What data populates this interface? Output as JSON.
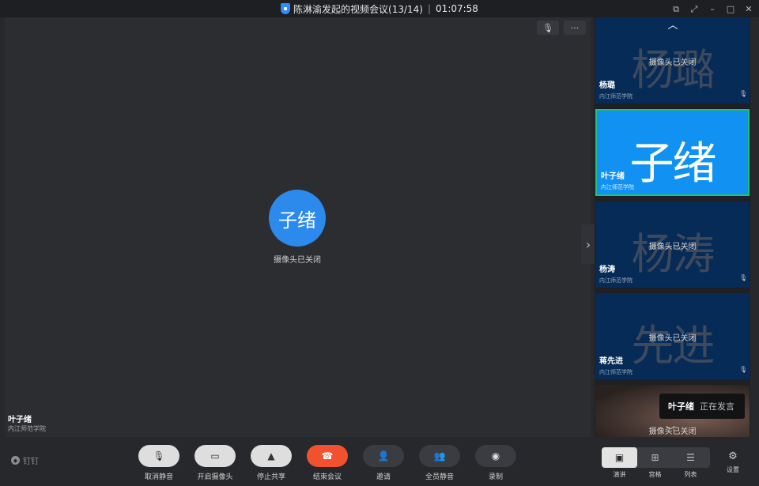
{
  "titlebar": {
    "title": "陈淋渝发起的视频会议(13/14)",
    "separator": "|",
    "duration": "01:07:58"
  },
  "stage": {
    "avatar_text": "子绪",
    "camera_status": "摄像头已关闭",
    "speaker_name": "叶子绪",
    "speaker_org": "内江师范学院"
  },
  "participants": [
    {
      "big": "杨璐",
      "cam_off": "摄像头已关闭",
      "name": "杨璐",
      "org": "内江师范学院"
    },
    {
      "big": "子绪",
      "cam_off": "",
      "name": "叶子绪",
      "org": "内江师范学院"
    },
    {
      "big": "杨涛",
      "cam_off": "摄像头已关闭",
      "name": "杨涛",
      "org": "内江师范学院"
    },
    {
      "big": "先进",
      "cam_off": "摄像头已关闭",
      "name": "蒋先进",
      "org": "内江师范学院"
    },
    {
      "big": "",
      "cam_off": "摄像头已关闭",
      "name": "",
      "org": ""
    }
  ],
  "speaking": {
    "name": "叶子绪",
    "status": "正在发言"
  },
  "toolbar": {
    "pin_label": "钉钉",
    "buttons": [
      {
        "label": "取消静音",
        "icon": "mic-muted-icon"
      },
      {
        "label": "开启摄像头",
        "icon": "camera-off-icon"
      },
      {
        "label": "停止共享",
        "icon": "share-icon"
      },
      {
        "label": "结束会议",
        "icon": "hangup-icon"
      },
      {
        "label": "邀请",
        "icon": "invite-icon"
      },
      {
        "label": "全员静音",
        "icon": "mute-all-icon"
      },
      {
        "label": "录制",
        "icon": "record-icon"
      }
    ],
    "views": [
      {
        "label": "演讲",
        "icon": "speaker-view-icon"
      },
      {
        "label": "宫格",
        "icon": "grid-view-icon"
      },
      {
        "label": "列表",
        "icon": "list-view-icon"
      }
    ],
    "settings_label": "设置"
  },
  "colors": {
    "accent": "#2b8aec",
    "active_tile": "#1192f2",
    "active_border": "#20c07a",
    "hangup": "#f2512e"
  }
}
